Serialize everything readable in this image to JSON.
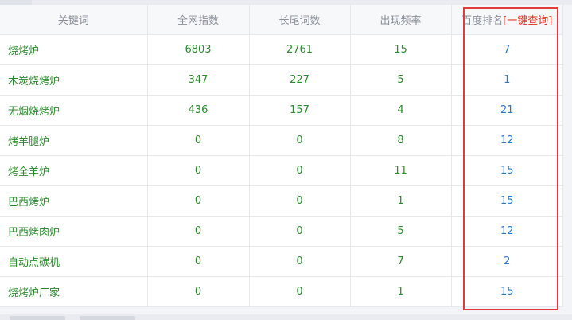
{
  "table": {
    "headers": {
      "keyword": "关键词",
      "index": "全网指数",
      "longtail": "长尾词数",
      "frequency": "出现频率",
      "rank": "百度排名",
      "query_link": "[一键查询]"
    },
    "rows": [
      {
        "keyword": "烧烤炉",
        "index": "6803",
        "longtail": "2761",
        "frequency": "15",
        "rank": "7"
      },
      {
        "keyword": "木炭烧烤炉",
        "index": "347",
        "longtail": "227",
        "frequency": "5",
        "rank": "1"
      },
      {
        "keyword": "无烟烧烤炉",
        "index": "436",
        "longtail": "157",
        "frequency": "4",
        "rank": "21"
      },
      {
        "keyword": "烤羊腿炉",
        "index": "0",
        "longtail": "0",
        "frequency": "8",
        "rank": "12"
      },
      {
        "keyword": "烤全羊炉",
        "index": "0",
        "longtail": "0",
        "frequency": "11",
        "rank": "15"
      },
      {
        "keyword": "巴西烤炉",
        "index": "0",
        "longtail": "0",
        "frequency": "1",
        "rank": "15"
      },
      {
        "keyword": "巴西烤肉炉",
        "index": "0",
        "longtail": "0",
        "frequency": "5",
        "rank": "12"
      },
      {
        "keyword": "自动点碳机",
        "index": "0",
        "longtail": "0",
        "frequency": "7",
        "rank": "2"
      },
      {
        "keyword": "烧烤炉厂家",
        "index": "0",
        "longtail": "0",
        "frequency": "1",
        "rank": "15"
      }
    ]
  },
  "colors": {
    "value_green": "#2d8a2d",
    "rank_blue": "#2a79c9",
    "query_red": "#d9341f",
    "highlight_red": "#e23b3b"
  }
}
